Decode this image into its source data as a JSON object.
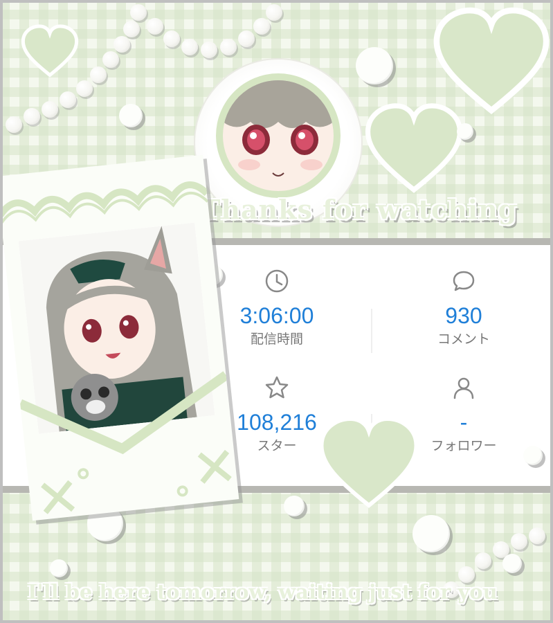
{
  "overlay": {
    "headline": "Thanks for watching",
    "footer_message": "I'll be here tomorrow, waiting just for you"
  },
  "stats": [
    {
      "icon": "clock-icon",
      "value": "3:06:00",
      "label": "配信時間"
    },
    {
      "icon": "comment-icon",
      "value": "930",
      "label": "コメント"
    },
    {
      "icon": "star-icon",
      "value": "108,216",
      "label": "スター"
    },
    {
      "icon": "user-icon",
      "value": "-",
      "label": "フォロワー"
    }
  ],
  "colors": {
    "accent_value": "#1f7fd8",
    "heart": "#dbe8cc",
    "frame": "#b7b7b2",
    "background": "#f4f8ee"
  }
}
